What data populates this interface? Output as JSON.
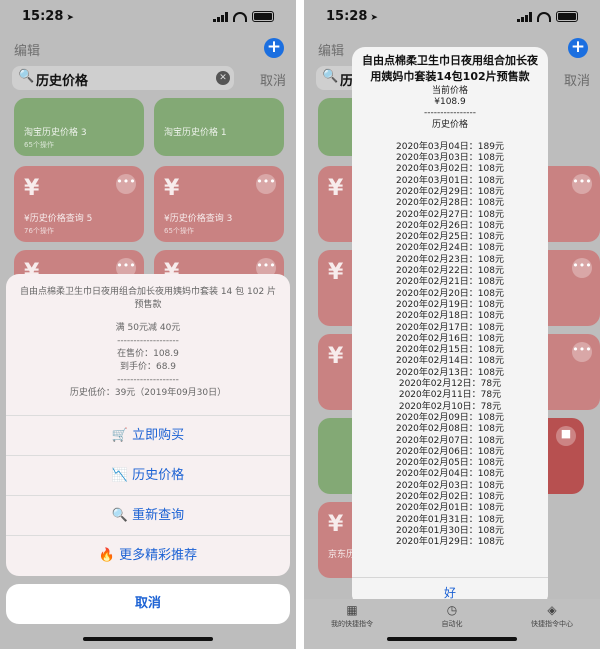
{
  "status_bar": {
    "time": "15:28"
  },
  "left_screen": {
    "header": {
      "edit_label": "编辑",
      "add_button": "+"
    },
    "search": {
      "query": "历史价格",
      "cancel_label": "取消"
    },
    "cards": [
      {
        "title": "淘宝历史价格 3",
        "subtitle": "65个操作"
      },
      {
        "title": "淘宝历史价格 1",
        "subtitle": ""
      },
      {
        "title": "¥历史价格查询 5",
        "subtitle": "76个操作"
      },
      {
        "title": "¥历史价格查询 3",
        "subtitle": "65个操作"
      },
      {
        "title": "京东历史",
        "subtitle": ""
      }
    ],
    "action_sheet": {
      "message_lines": [
        "自由点棉柔卫生巾日夜用组合加长夜用姨妈巾套装 14 包 102 片",
        "预售款",
        "",
        "满 50元减 40元",
        "-------------------",
        "在售价：108.9",
        "到手价：68.9",
        "-------------------",
        "历史低价：39元（2019年09月30日）"
      ],
      "actions": [
        {
          "icon": "🛒",
          "label": "立即购买"
        },
        {
          "icon": "📉",
          "label": "历史价格"
        },
        {
          "icon": "🔍",
          "label": "重新查询"
        },
        {
          "icon": "🔥",
          "label": "更多精彩推荐"
        }
      ],
      "cancel_label": "取消"
    }
  },
  "right_screen": {
    "search_partial": "历史",
    "cancel_label": "取消",
    "alert": {
      "title": "自由点棉柔卫生巾日夜用组合加长夜用姨妈巾套装14包102片预售款",
      "current_price_label": "当前价格",
      "current_price": "¥108.9",
      "divider": "----------------",
      "history_label": "历史价格",
      "history": [
        "2020年03月04日：189元",
        "2020年03月03日：108元",
        "2020年03月02日：108元",
        "2020年03月01日：108元",
        "2020年02月29日：108元",
        "2020年02月28日：108元",
        "2020年02月27日：108元",
        "2020年02月26日：108元",
        "2020年02月25日：108元",
        "2020年02月24日：108元",
        "2020年02月23日：108元",
        "2020年02月22日：108元",
        "2020年02月21日：108元",
        "2020年02月20日：108元",
        "2020年02月19日：108元",
        "2020年02月18日：108元",
        "2020年02月17日：108元",
        "2020年02月16日：108元",
        "2020年02月15日：108元",
        "2020年02月14日：108元",
        "2020年02月13日：108元",
        "2020年02月12日：78元",
        "2020年02月11日：78元",
        "2020年02月10日：78元",
        "2020年02月09日：108元",
        "2020年02月08日：108元",
        "2020年02月07日：108元",
        "2020年02月06日：108元",
        "2020年02月05日：108元",
        "2020年02月04日：108元",
        "2020年02月03日：108元",
        "2020年02月02日：108元",
        "2020年02月01日：108元",
        "2020年01月31日：108元",
        "2020年01月30日：108元",
        "2020年01月29日：108元"
      ],
      "ok_label": "好"
    },
    "tabs": [
      {
        "icon": "▦",
        "label": "我的快捷指令"
      },
      {
        "icon": "◷",
        "label": "自动化"
      },
      {
        "icon": "◈",
        "label": "快捷指令中心"
      }
    ]
  }
}
